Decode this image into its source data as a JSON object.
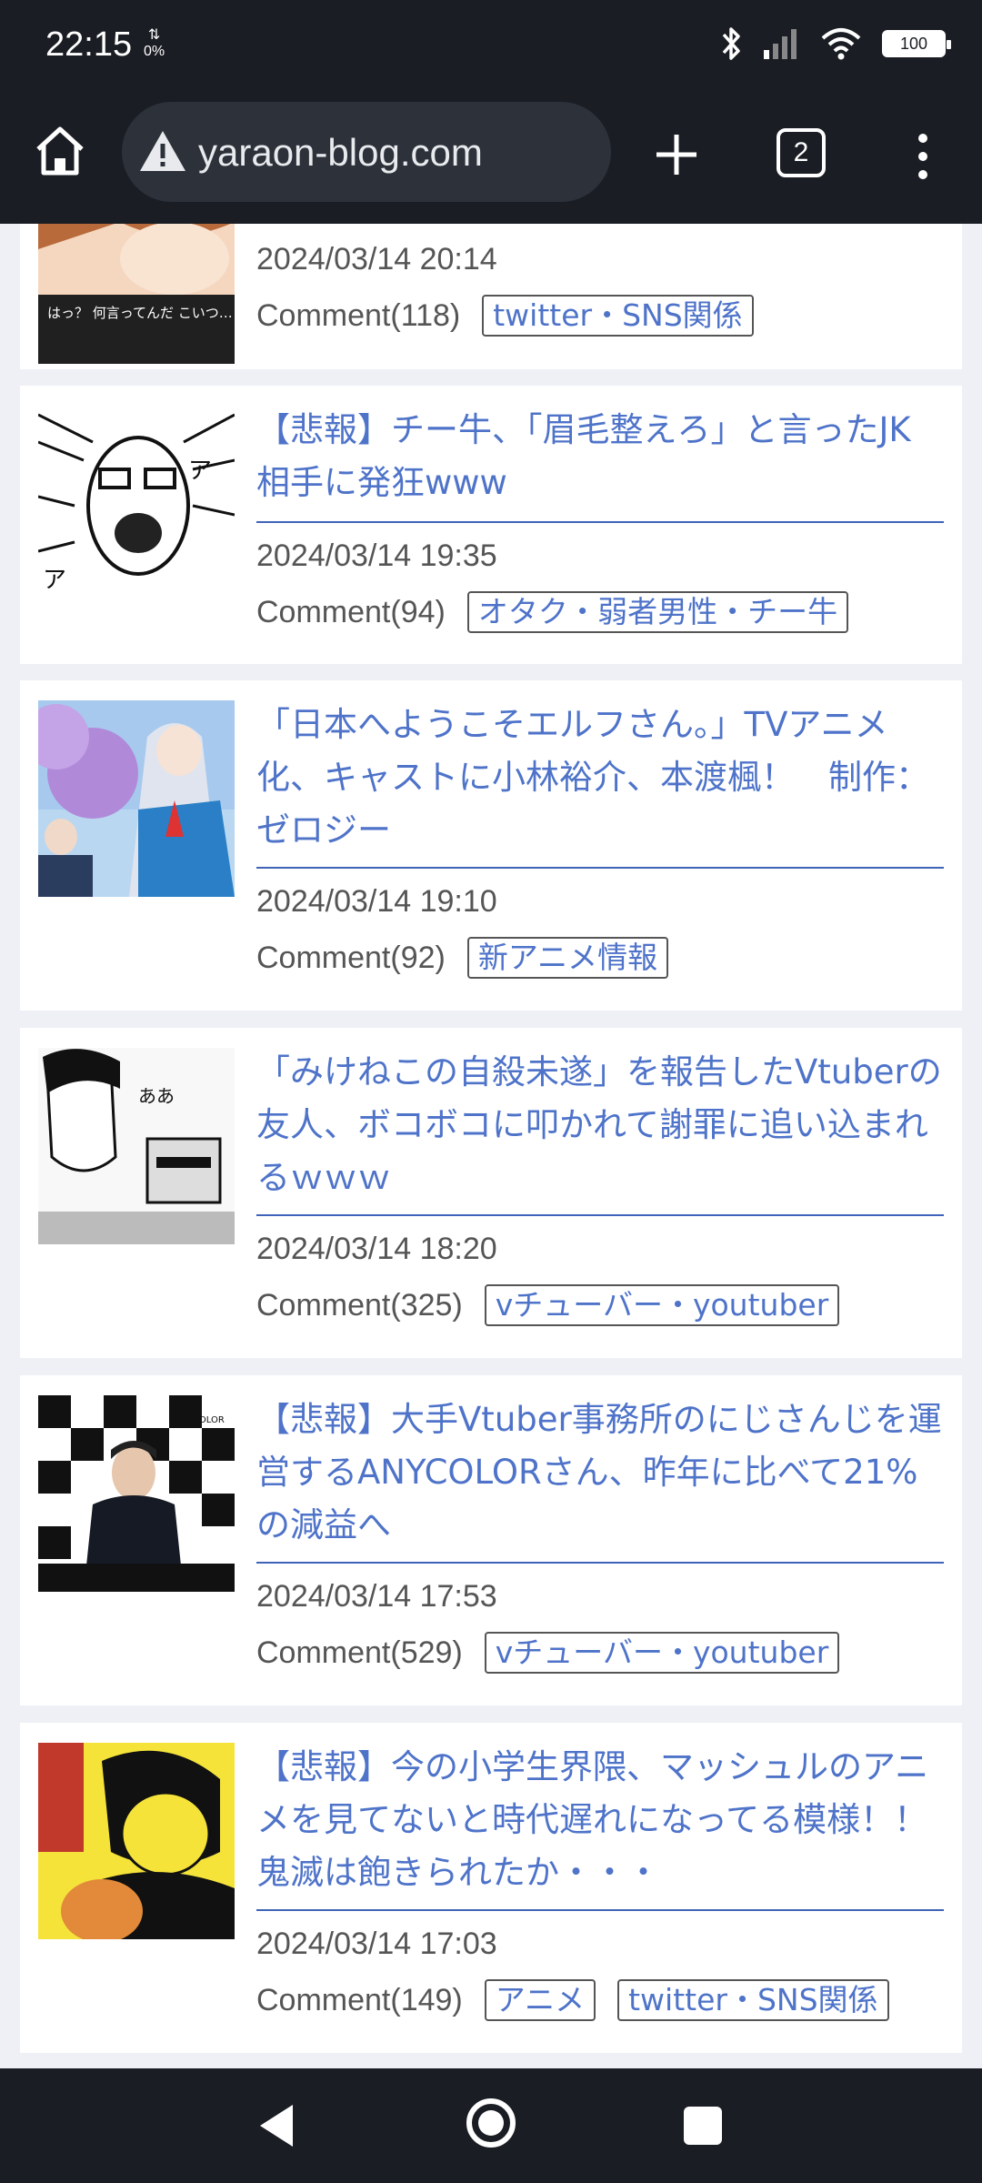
{
  "status": {
    "time": "22:15",
    "data_rate": "0%",
    "battery": "100"
  },
  "browser": {
    "url": "yaraon-blog.com",
    "tab_count": "2"
  },
  "articles": [
    {
      "title": "",
      "thumb_caption": "はっ？ 何言ってんだ こいつ…",
      "date": "2024/03/14 20:14",
      "comment": "Comment(118)",
      "tags": [
        "twitter・SNS関係"
      ]
    },
    {
      "title": "【悲報】チー牛、「眉毛整えろ」と言ったJK相手に発狂www",
      "date": "2024/03/14 19:35",
      "comment": "Comment(94)",
      "tags": [
        "オタク・弱者男性・チー牛"
      ]
    },
    {
      "title": "「日本へようこそエルフさん。」TVアニメ化、キャストに小林裕介、本渡楓！　制作：ゼロジー",
      "date": "2024/03/14 19:10",
      "comment": "Comment(92)",
      "tags": [
        "新アニメ情報"
      ]
    },
    {
      "title": "「みけねこの自殺未遂」を報告したVtuberの友人、ボコボコに叩かれて謝罪に追い込まれるｗｗｗ",
      "thumb_caption": "ああ",
      "date": "2024/03/14 18:20",
      "comment": "Comment(325)",
      "tags": [
        "vチューバー・youtuber"
      ]
    },
    {
      "title": "【悲報】大手Vtuber事務所のにじさんじを運営するANYCOLORさん、昨年に比べて21%の減益へ",
      "thumb_caption": "ANYCOLOR",
      "date": "2024/03/14 17:53",
      "comment": "Comment(529)",
      "tags": [
        "vチューバー・youtuber"
      ]
    },
    {
      "title": "【悲報】今の小学生界隈、マッシュルのアニメを見てないと時代遅れになってる模様！！　鬼滅は飽きられたか・・・",
      "date": "2024/03/14 17:03",
      "comment": "Comment(149)",
      "tags": [
        "アニメ",
        "twitter・SNS関係"
      ]
    }
  ],
  "colors": {
    "link": "#4e73c9",
    "bar": "#1a1d24",
    "page_bg": "#eef0f6"
  }
}
